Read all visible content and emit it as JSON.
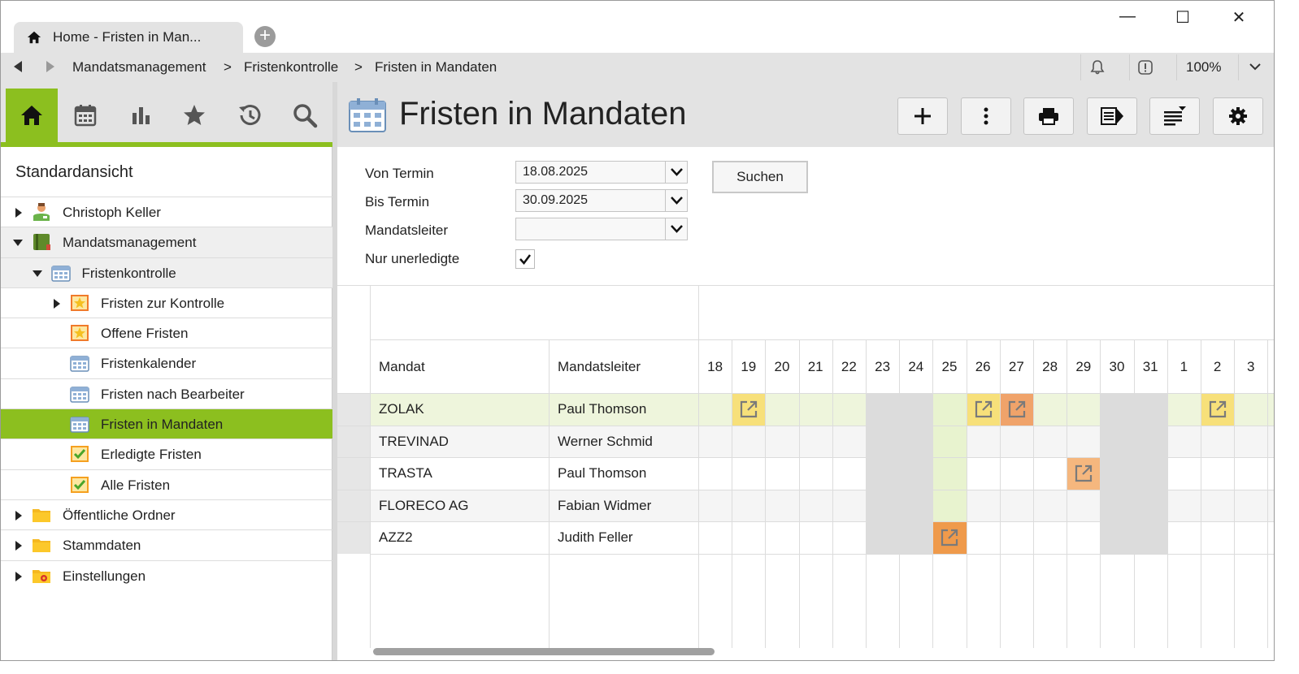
{
  "window": {
    "tab_title": "Home - Fristen in Man...",
    "minimize": "—",
    "maximize": "☐",
    "close": "✕"
  },
  "nav": {
    "breadcrumbs": [
      "Mandatsmanagement",
      ">",
      "Fristenkontrolle",
      ">",
      "Fristen in Mandaten"
    ],
    "zoom": "100%"
  },
  "sidebar": {
    "icons": [
      "home-icon",
      "calendar-icon",
      "chart-icon",
      "star-icon",
      "history-icon",
      "search-icon"
    ],
    "title": "Standardansicht",
    "tree": [
      {
        "label": "Christoph Keller",
        "level": 0,
        "arrow": "right",
        "icon": "user-icon"
      },
      {
        "label": "Mandatsmanagement",
        "level": 0,
        "arrow": "down",
        "icon": "book-icon",
        "state": "gray"
      },
      {
        "label": "Fristenkontrolle",
        "level": 1,
        "arrow": "down",
        "icon": "calendar-icon",
        "state": "gray"
      },
      {
        "label": "Fristen zur Kontrolle",
        "level": 2,
        "arrow": "right",
        "icon": "star-note-icon"
      },
      {
        "label": "Offene Fristen",
        "level": 2,
        "arrow": "",
        "icon": "star-note-icon"
      },
      {
        "label": "Fristenkalender",
        "level": 2,
        "arrow": "",
        "icon": "calendar-icon"
      },
      {
        "label": "Fristen nach Bearbeiter",
        "level": 2,
        "arrow": "",
        "icon": "calendar-icon"
      },
      {
        "label": "Fristen in Mandaten",
        "level": 2,
        "arrow": "",
        "icon": "calendar-icon",
        "state": "sel"
      },
      {
        "label": "Erledigte Fristen",
        "level": 2,
        "arrow": "",
        "icon": "check-note-icon"
      },
      {
        "label": "Alle Fristen",
        "level": 2,
        "arrow": "",
        "icon": "check-note-icon"
      },
      {
        "label": "Öffentliche Ordner",
        "level": 0,
        "arrow": "right",
        "icon": "folder-icon"
      },
      {
        "label": "Stammdaten",
        "level": 0,
        "arrow": "right",
        "icon": "folder-icon"
      },
      {
        "label": "Einstellungen",
        "level": 0,
        "arrow": "right",
        "icon": "settings-folder-icon"
      }
    ]
  },
  "main": {
    "title": "Fristen in Mandaten",
    "toolbar": [
      "add-icon",
      "more-icon",
      "print-icon",
      "export-icon",
      "sort-icon",
      "gear-icon"
    ],
    "filters": {
      "von_label": "Von Termin",
      "von_value": "18.08.2025",
      "bis_label": "Bis Termin",
      "bis_value": "30.09.2025",
      "leiter_label": "Mandatsleiter",
      "leiter_value": "",
      "offen_label": "Nur unerledigte",
      "offen_checked": true,
      "search_label": "Suchen"
    },
    "grid": {
      "col_mandat": "Mandat",
      "col_leiter": "Mandatsleiter",
      "days": [
        "18",
        "19",
        "20",
        "21",
        "22",
        "23",
        "24",
        "25",
        "26",
        "27",
        "28",
        "29",
        "30",
        "31",
        "1",
        "2",
        "3"
      ],
      "weekend_idx": [
        5,
        6,
        12,
        13
      ],
      "today_idx": 7,
      "rows": [
        {
          "mandat": "ZOLAK",
          "leiter": "Paul Thomson",
          "highlight": true,
          "events": [
            {
              "day": 1,
              "color": "#f7e07a"
            },
            {
              "day": 8,
              "color": "#f7e07a"
            },
            {
              "day": 9,
              "color": "#f0a36a"
            },
            {
              "day": 15,
              "color": "#f7e07a"
            }
          ]
        },
        {
          "mandat": "TREVINAD",
          "leiter": "Werner Schmid",
          "events": []
        },
        {
          "mandat": "TRASTA",
          "leiter": "Paul Thomson",
          "events": [
            {
              "day": 11,
              "color": "#f5b77e"
            }
          ]
        },
        {
          "mandat": "FLORECO AG",
          "leiter": "Fabian Widmer",
          "events": []
        },
        {
          "mandat": "AZZ2",
          "leiter": "Judith Feller",
          "events": [
            {
              "day": 7,
              "color": "#ef9a4b"
            }
          ]
        }
      ]
    }
  },
  "colors": {
    "accent": "#8cbf1f",
    "weekend": "#dcdcdc",
    "today": "#e8f3cf",
    "rowhl": "#eef5dc"
  }
}
